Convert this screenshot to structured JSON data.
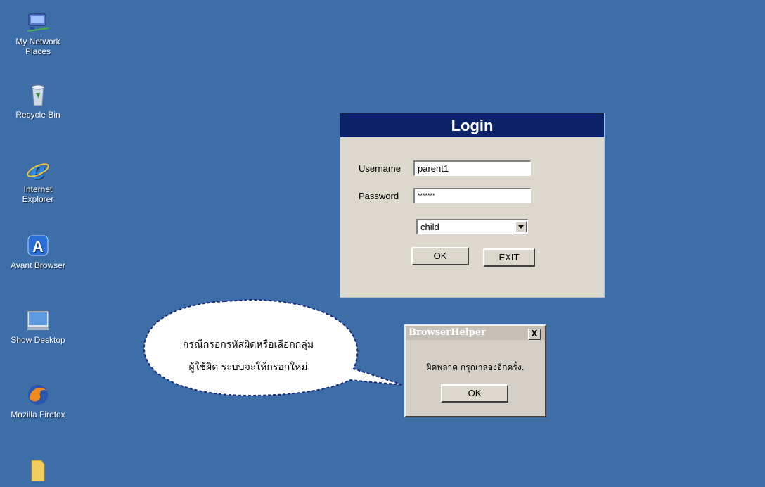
{
  "desktop": {
    "icons": [
      {
        "label_lines": [
          "My Network",
          "Places"
        ],
        "icon": "network-places-icon"
      },
      {
        "label_lines": [
          "Recycle Bin"
        ],
        "icon": "recycle-bin-icon"
      },
      {
        "label_lines": [
          "Internet",
          "Explorer"
        ],
        "icon": "internet-explorer-icon"
      },
      {
        "label_lines": [
          "Avant Browser"
        ],
        "icon": "avant-browser-icon"
      },
      {
        "label_lines": [
          "Show Desktop"
        ],
        "icon": "show-desktop-icon"
      },
      {
        "label_lines": [
          "Mozilla Firefox"
        ],
        "icon": "firefox-icon"
      },
      {
        "label_lines": [
          ""
        ],
        "icon": "folder-icon"
      }
    ],
    "background_color": "#3d6ea8"
  },
  "login": {
    "title": "Login",
    "username_label": "Username",
    "username_value": "parent1",
    "password_label": "Password",
    "password_value": "*******",
    "group_selected": "child",
    "ok_label": "OK",
    "exit_label": "EXIT"
  },
  "error_dialog": {
    "title": "BrowserHelper",
    "close_label": "X",
    "message": "ผิดพลาด กรุณาลองอีกครั้ง.",
    "ok_label": "OK"
  },
  "callout": {
    "line1": "กรณีกรอกรหัสผิดหรือเลือกกลุ่ม",
    "line2": "ผู้ใช้ผิด ระบบจะให้กรอกใหม่"
  }
}
